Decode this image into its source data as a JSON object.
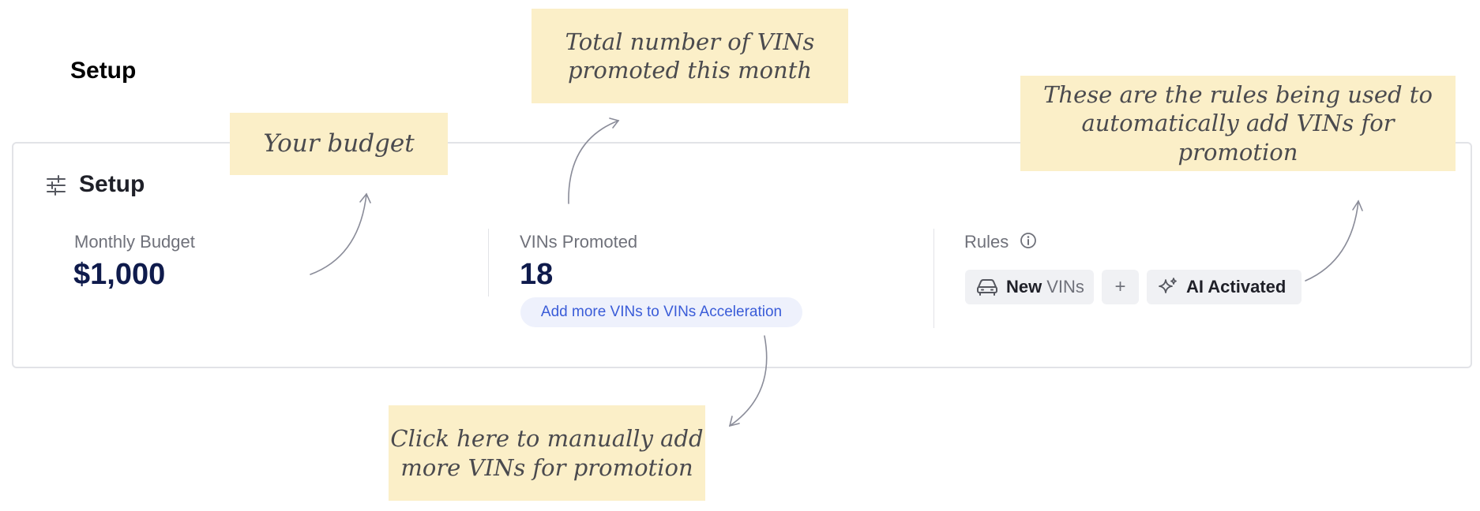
{
  "page": {
    "heading": "Setup"
  },
  "setup_card": {
    "title": "Setup",
    "icon": "sliders-icon",
    "monthly_budget": {
      "label": "Monthly Budget",
      "value": "$1,000"
    },
    "vins_promoted": {
      "label": "VINs Promoted",
      "value": "18",
      "add_link": "Add more VINs to VINs Acceleration"
    },
    "rules": {
      "label": "Rules",
      "info_icon": "info-icon",
      "new_chip": {
        "icon": "car-icon",
        "bold": "New",
        "rest": "VINs"
      },
      "plus": "+",
      "ai_chip": {
        "icon": "sparkle-icon",
        "label": "AI Activated"
      }
    }
  },
  "annotations": {
    "budget": "Your budget",
    "vins_total_line1": "Total number of VINs",
    "vins_total_line2": "promoted this month",
    "rules_line1": "These are the rules being used to",
    "rules_line2": "automatically add VINs for promotion",
    "manual_line1": "Click here to manually add",
    "manual_line2": "more VINs for promotion"
  },
  "colors": {
    "note_background": "#fbefc8",
    "value_navy": "#0f1b4c",
    "link_blue": "#3a5cd8",
    "card_border": "#e2e3e7"
  }
}
